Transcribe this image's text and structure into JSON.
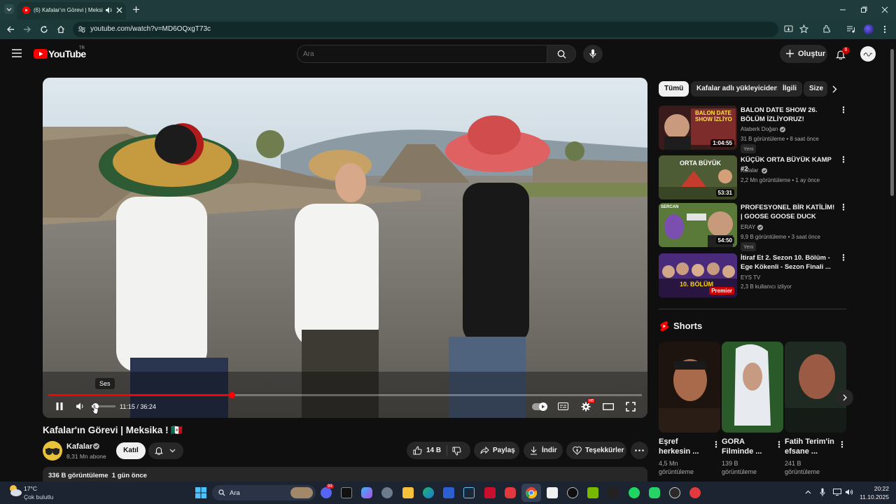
{
  "browser": {
    "tab_title": "(6) Kafalar'ın Görevi | Meksi",
    "url": "youtube.com/watch?v=MD6OQxgT73c"
  },
  "youtube": {
    "logo_text": "YouTube",
    "region": "TR",
    "search_placeholder": "Ara",
    "create_label": "Oluştur",
    "notification_count": "6"
  },
  "player": {
    "tooltip": "Ses",
    "time_current": "11:15",
    "time_separator": " / ",
    "time_total": "36:24",
    "progress_fraction": 0.309,
    "volume_fraction": 0.15,
    "hd_badge": "HD"
  },
  "video": {
    "title": "Kafalar'ın Görevi | Meksika ! 🇲🇽",
    "channel": "Kafalar",
    "subscribers": "8,31 Mn abone",
    "join_label": "Katıl",
    "likes": "14 B",
    "share_label": "Paylaş",
    "download_label": "İndir",
    "thanks_label": "Teşekkürler",
    "views_line": "336 B görüntüleme  1 gün önce"
  },
  "chips": [
    "Tümü",
    "Kafalar adlı yükleyiciden",
    "İlgili",
    "Size"
  ],
  "recommendations": [
    {
      "title": "BALON DATE SHOW 26. BÖLÜM İZLİYORUZ!",
      "channel": "Ataberk Doğan",
      "meta": "31 B görüntüleme • 8 saat önce",
      "badge": "Yeni",
      "duration": "1:04:55",
      "thumb_text": "BALON DATE SHOW İZLİYO"
    },
    {
      "title": "KÜÇÜK ORTA BÜYÜK KAMP #2",
      "channel": "Kafalar",
      "meta": "2,2 Mn görüntüleme • 1 ay önce",
      "badge": "",
      "duration": "53:31",
      "thumb_text": "ORTA BÜYÜK"
    },
    {
      "title": "PROFESYONEL BİR KATİLİM! | GOOSE GOOSE DUCK",
      "channel": "ERAY",
      "meta": "9,9 B görüntüleme • 3 saat önce",
      "badge": "Yeni",
      "duration": "54:50",
      "thumb_text": "SERCAN"
    },
    {
      "title": "İtiraf Et 2. Sezon 10. Bölüm - Ege Kökenli - Sezon Finali ...",
      "channel": "EYS TV",
      "meta": "2,3 B kullanıcı izliyor",
      "badge": "",
      "duration": "Premier",
      "thumb_text": "10. BÖLÜM"
    }
  ],
  "shorts": {
    "heading": "Shorts",
    "items": [
      {
        "title": "Eşref herkesin ...",
        "views": "4,5 Mn görüntüleme"
      },
      {
        "title": "GORA Filminde ...",
        "views": "139 B görüntüleme"
      },
      {
        "title": "Fatih Terim'in efsane ...",
        "views": "241 B görüntüleme"
      }
    ]
  },
  "taskbar": {
    "weather_temp": "17°C",
    "weather_desc": "Çok bulutlu",
    "search_label": "Ara",
    "time": "20:22",
    "date": "11.10.2025",
    "badge_count": "99"
  },
  "colors": {
    "yt_red": "#ff0000",
    "chrome_teal": "#1f3b3b",
    "page_bg": "#0f0f0f",
    "taskbar_bg": "#1c2331"
  }
}
